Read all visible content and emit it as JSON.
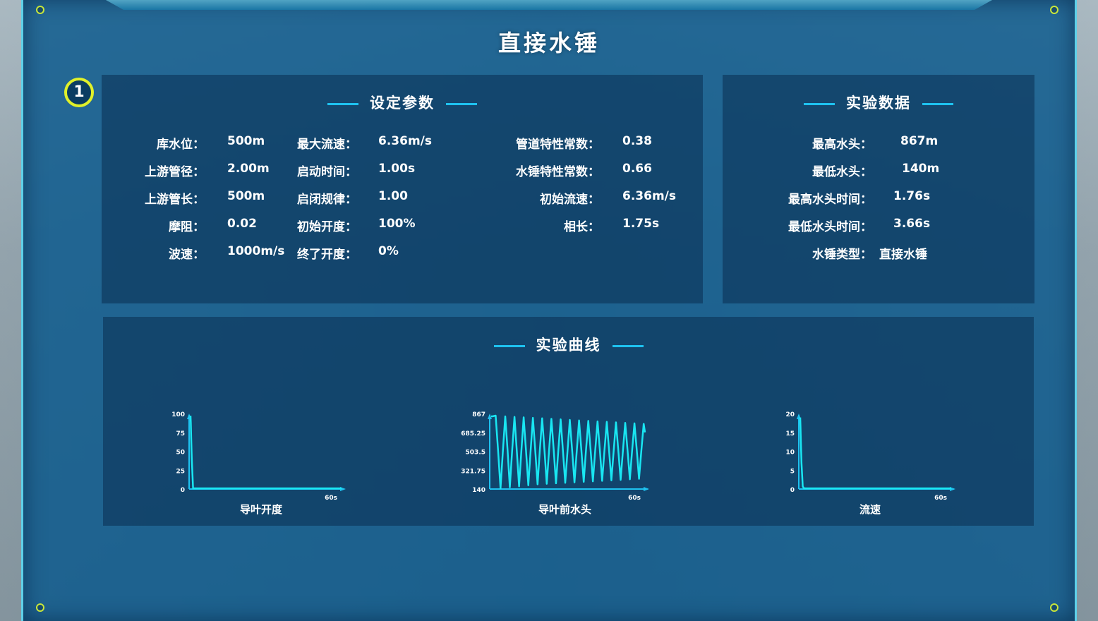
{
  "title": "直接水锤",
  "step_badge": "1",
  "settings": {
    "heading": "设定参数",
    "col1": [
      {
        "label": "库水位：",
        "value": "500m"
      },
      {
        "label": "上游管径：",
        "value": "2.00m"
      },
      {
        "label": "上游管长：",
        "value": "500m"
      },
      {
        "label": "摩阻：",
        "value": "0.02"
      },
      {
        "label": "波速：",
        "value": "1000m/s"
      }
    ],
    "col2": [
      {
        "label": "最大流速：",
        "value": "6.36m/s"
      },
      {
        "label": "启动时间：",
        "value": "1.00s"
      },
      {
        "label": "启闭规律：",
        "value": "1.00"
      },
      {
        "label": "初始开度：",
        "value": "100%"
      },
      {
        "label": "终了开度：",
        "value": "0%"
      }
    ],
    "col3": [
      {
        "label": "管道特性常数：",
        "value": "0.38"
      },
      {
        "label": "水锤特性常数：",
        "value": "0.66"
      },
      {
        "label": "初始流速：",
        "value": "6.36m/s"
      },
      {
        "label": "相长：",
        "value": "1.75s"
      }
    ]
  },
  "results": {
    "heading": "实验数据",
    "rows": [
      {
        "label": "最高水头：",
        "value": "867m"
      },
      {
        "label": "最低水头：",
        "value": "140m"
      },
      {
        "label": "最高水头时间：",
        "value": "1.76s"
      },
      {
        "label": "最低水头时间：",
        "value": "3.66s"
      },
      {
        "label": "水锤类型：",
        "value": "直接水锤"
      }
    ]
  },
  "curves_heading": "实验曲线",
  "colors": {
    "accent": "#1ec2f0",
    "line": "#19e6f2",
    "badge": "#e0f02a"
  },
  "chart_data": [
    {
      "type": "line",
      "title": "导叶开度",
      "yticks": [
        "100",
        "75",
        "50",
        "25",
        "0"
      ],
      "ylim": [
        0,
        100
      ],
      "xlim": [
        0,
        60
      ],
      "xtick_end": "60s",
      "x": [
        0,
        0.1,
        0.25,
        0.5,
        1,
        1.5,
        60
      ],
      "y": [
        100,
        90,
        70,
        40,
        0,
        0,
        0
      ]
    },
    {
      "type": "line",
      "title": "导叶前水头",
      "yticks": [
        "867",
        "685.25",
        "503.5",
        "321.75",
        "140"
      ],
      "ylim": [
        140,
        867
      ],
      "xlim": [
        0,
        60
      ],
      "xtick_end": "60s",
      "x": [
        0,
        0.5,
        1.76,
        2.7,
        3.66,
        4.6,
        5.5,
        6.4,
        7.3,
        8.2,
        9.1,
        10.0,
        10.9,
        11.8,
        12.7,
        13.6,
        14.5,
        15.4,
        16.3,
        17.2,
        18.1,
        19.0,
        19.9,
        20.8,
        21.7,
        22.6,
        23.5,
        24.4,
        25.3,
        26.2,
        27.1,
        28.0,
        28.9,
        29.8,
        30.7,
        31.6,
        32.5,
        33.4,
        34.3,
        35.2,
        36.1,
        37.0,
        37.9,
        38.8,
        39.7,
        40.6,
        41.5,
        42.4,
        43.3,
        44.2,
        45.1,
        46.0,
        46.9,
        47.8,
        48.7,
        49.6,
        50.5,
        51.4,
        52.3,
        53.2,
        54.1,
        55.0,
        55.9,
        56.8,
        57.7,
        58.6,
        59.5,
        60
      ],
      "y": [
        860,
        860,
        867,
        520,
        140,
        520,
        860,
        520,
        150,
        520,
        855,
        520,
        160,
        520,
        850,
        520,
        170,
        520,
        845,
        520,
        180,
        520,
        840,
        520,
        185,
        520,
        835,
        520,
        190,
        520,
        830,
        520,
        195,
        520,
        825,
        520,
        200,
        520,
        820,
        520,
        205,
        520,
        815,
        520,
        210,
        520,
        810,
        520,
        215,
        520,
        805,
        520,
        220,
        520,
        800,
        520,
        225,
        520,
        795,
        520,
        230,
        520,
        790,
        520,
        235,
        520,
        785,
        700
      ]
    },
    {
      "type": "line",
      "title": "流速",
      "yticks": [
        "20",
        "15",
        "10",
        "5",
        "0"
      ],
      "ylim": [
        0,
        20
      ],
      "xlim": [
        0,
        60
      ],
      "xtick_end": "60s",
      "x": [
        0,
        0.1,
        0.25,
        0.5,
        1,
        1.5,
        60
      ],
      "y": [
        19.5,
        17,
        13,
        7,
        0.5,
        0,
        0
      ]
    }
  ]
}
